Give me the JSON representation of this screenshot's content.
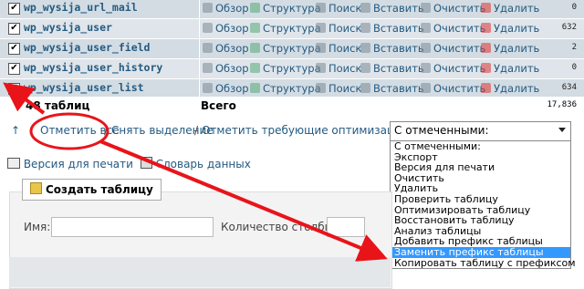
{
  "tables": [
    {
      "name": "wp_wysija_url_mail",
      "count": "0",
      "alt": false
    },
    {
      "name": "wp_wysija_user",
      "count": "632",
      "alt": true
    },
    {
      "name": "wp_wysija_user_field",
      "count": "2",
      "alt": false
    },
    {
      "name": "wp_wysija_user_history",
      "count": "0",
      "alt": true
    },
    {
      "name": "wp_wysija_user_list",
      "count": "634",
      "alt": false
    }
  ],
  "actions": {
    "browse": "Обзор",
    "structure": "Структура",
    "search": "Поиск",
    "insert": "Вставить",
    "empty": "Очистить",
    "drop": "Удалить"
  },
  "summary": {
    "tables": "48 таблиц",
    "total": "Всего",
    "rows": "17,836"
  },
  "check_all": "Отметить все",
  "uncheck_all": "Снять выделение",
  "separator": "/",
  "check_overhead": "Отметить требующие оптимизации",
  "with_selected": "С отмеченными:",
  "dropdown_options": [
    "С отмеченными:",
    "Экспорт",
    "Версия для печати",
    "Очистить",
    "Удалить",
    "Проверить таблицу",
    "Оптимизировать таблицу",
    "Восстановить таблицу",
    "Анализ таблицы",
    "Добавить префикс таблицы",
    "Заменить префикс таблицы",
    "Копировать таблицу с префиксом"
  ],
  "highlighted_option_index": 10,
  "print_view": "Версия для печати",
  "data_dictionary": "Словарь данных",
  "create_table": "Создать таблицу",
  "name_label": "Имя:",
  "columns_label": "Количество столбцов:",
  "colors": {
    "row": "#d3dce3",
    "row_alt": "#dfe5ea",
    "link": "#235a81",
    "highlight": "#3399ff",
    "arrow": "#e8141a"
  }
}
